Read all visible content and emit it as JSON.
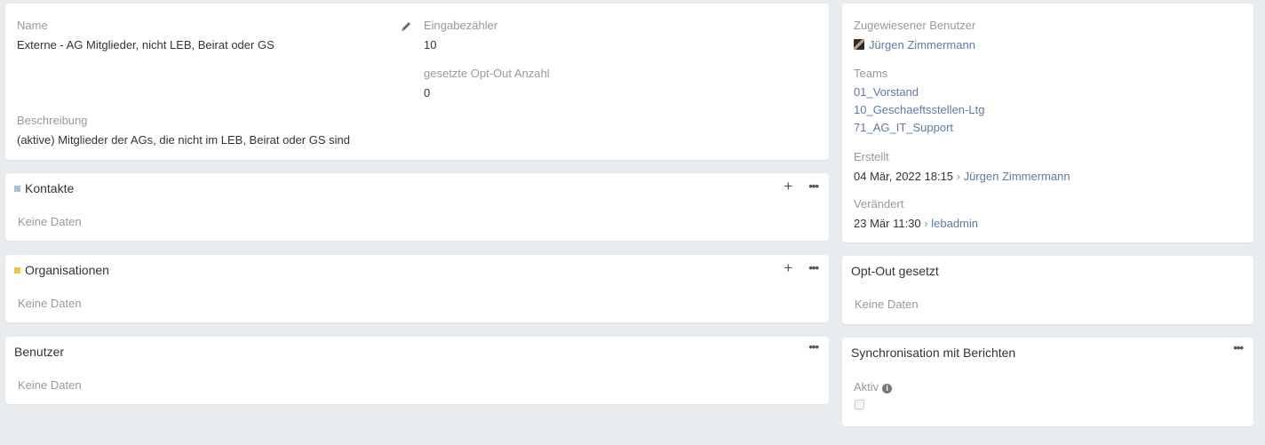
{
  "detail": {
    "name_label": "Name",
    "name_value": "Externe - AG Mitglieder, nicht LEB, Beirat oder GS",
    "entry_count_label": "Eingabezähler",
    "entry_count_value": "10",
    "optout_count_label": "gesetzte Opt-Out Anzahl",
    "optout_count_value": "0",
    "description_label": "Beschreibung",
    "description_value": "(aktive) Mitglieder der AGs, die nicht im LEB, Beirat oder GS sind",
    "edit_icon": "pencil-icon"
  },
  "relations": {
    "kontakte": {
      "title": "Kontakte",
      "empty": "Keine Daten",
      "color": "#a8c0dc"
    },
    "organisationen": {
      "title": "Organisationen",
      "empty": "Keine Daten",
      "color": "#e8c84a"
    },
    "benutzer": {
      "title": "Benutzer",
      "empty": "Keine Daten"
    }
  },
  "side": {
    "assigned_label": "Zugewiesener Benutzer",
    "assigned_user": "Jürgen Zimmermann",
    "teams_label": "Teams",
    "teams": [
      "01_Vorstand",
      "10_Geschaeftsstellen-Ltg",
      "71_AG_IT_Support"
    ],
    "created_label": "Erstellt",
    "created_date": "04 Mär, 2022 18:15",
    "created_by": "Jürgen Zimmermann",
    "modified_label": "Verändert",
    "modified_date": "23 Mär 11:30",
    "modified_by": "lebadmin",
    "separator": "›"
  },
  "optout": {
    "title": "Opt-Out gesetzt",
    "empty": "Keine Daten"
  },
  "sync": {
    "title": "Synchronisation mit Berichten",
    "aktiv_label": "Aktiv",
    "aktiv_checked": false
  },
  "icons": {
    "plus": "+",
    "more": "•••",
    "info": "i"
  }
}
